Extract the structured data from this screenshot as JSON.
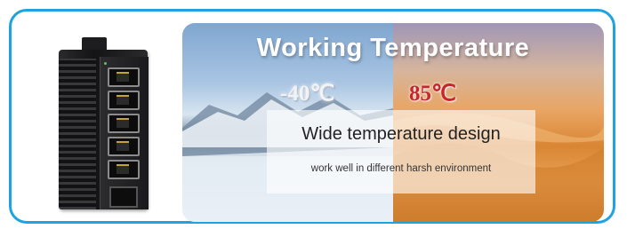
{
  "banner": {
    "title": "Working Temperature",
    "temp_low": "-40℃",
    "temp_high": "85℃",
    "headline": "Wide temperature design",
    "subline": "work well in different harsh environment"
  },
  "colors": {
    "frame_border": "#1fa3e0",
    "temp_high_color": "#c7262a"
  },
  "icons": {
    "product": "industrial-ethernet-switch-image"
  }
}
